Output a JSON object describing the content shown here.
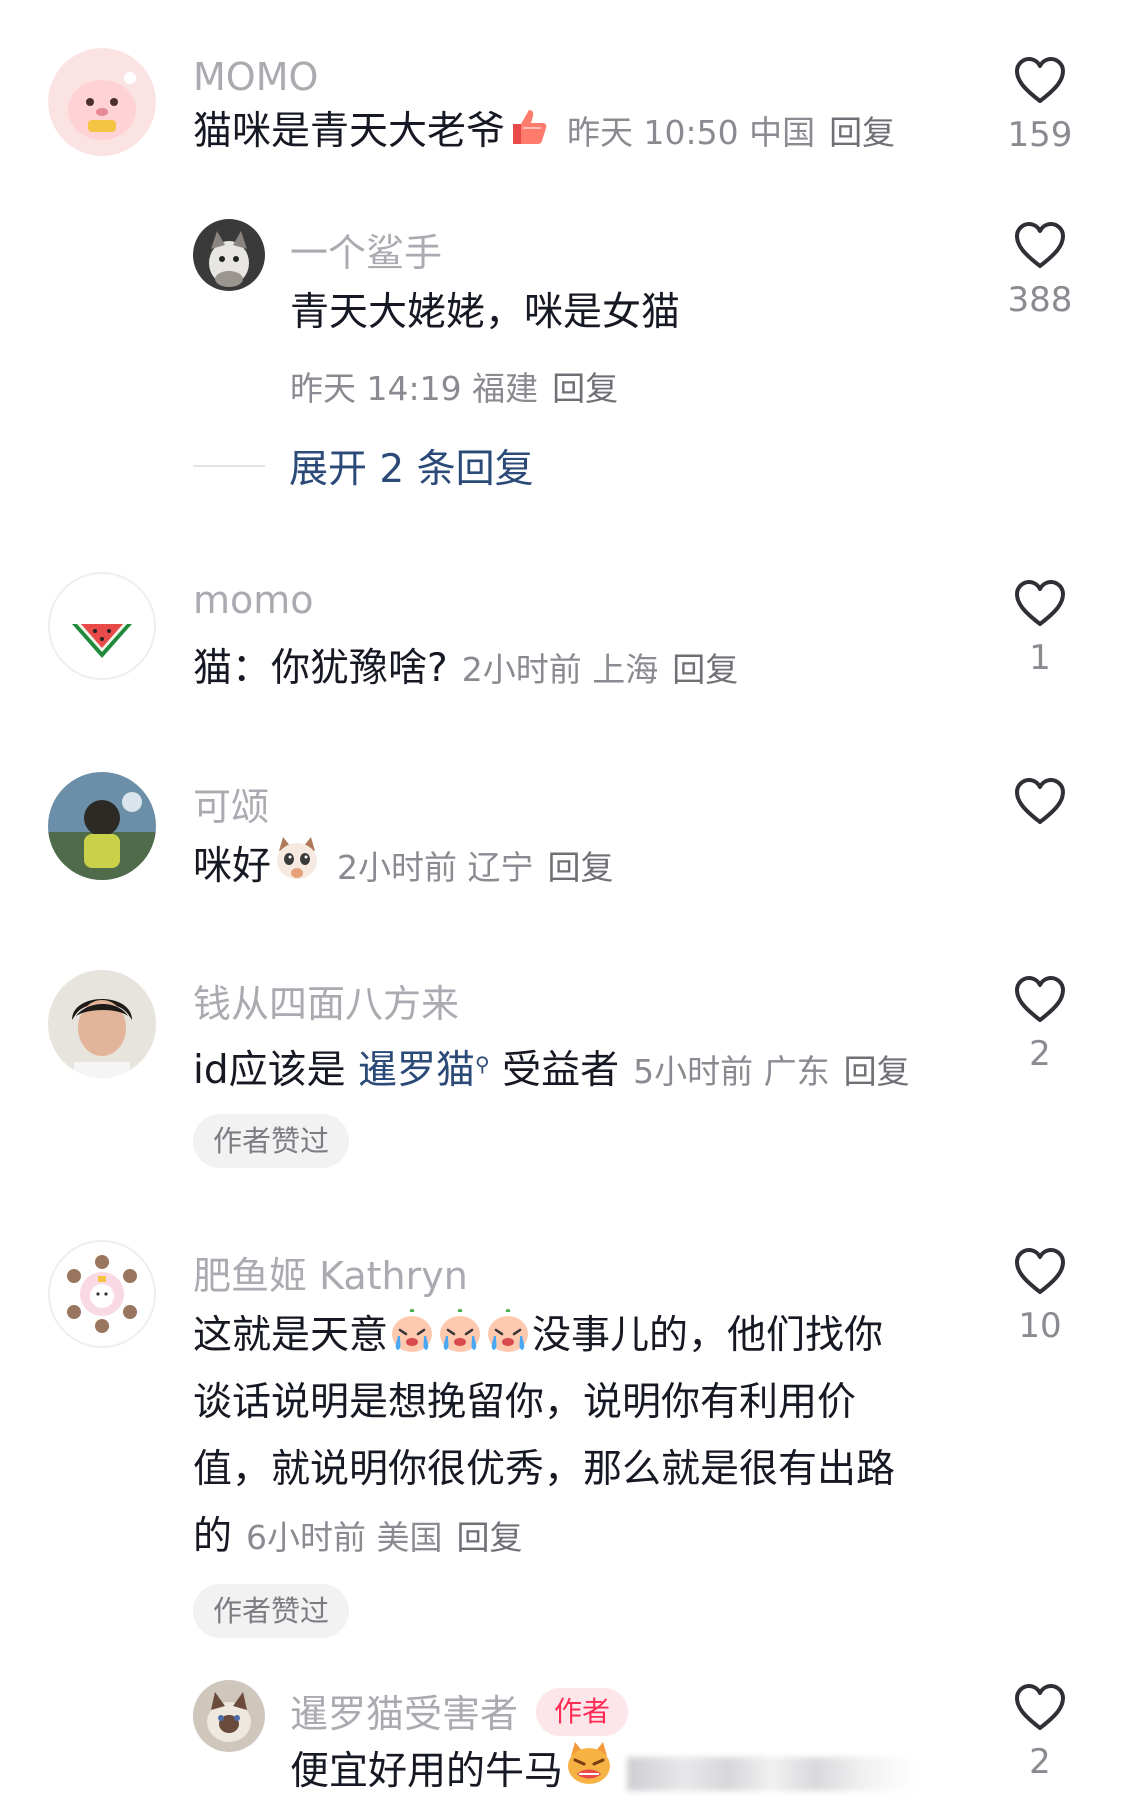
{
  "comments": [
    {
      "username": "MOMO",
      "text": "猫咪是青天大老爷",
      "time": "昨天 10:50",
      "location": "中国",
      "reply_label": "回复",
      "likes": "159",
      "emoji": "thumbs-up-emoji",
      "replies": [
        {
          "username": "一个鲨手",
          "text": "青天大姥姥，咪是女猫",
          "time": "昨天 14:19",
          "location": "福建",
          "reply_label": "回复",
          "likes": "388"
        }
      ],
      "expand_label": "展开 2 条回复"
    },
    {
      "username": "momo",
      "text": "猫：你犹豫啥?",
      "time": "2小时前",
      "location": "上海",
      "reply_label": "回复",
      "likes": "1"
    },
    {
      "username": "可颂",
      "text": "咪好",
      "time": "2小时前",
      "location": "辽宁",
      "reply_label": "回复",
      "likes": "",
      "emoji": "cat-thinking-emoji"
    },
    {
      "username": "钱从四面八方来",
      "text_before": "id应该是 ",
      "mention": "暹罗猫",
      "text_after": " 受益者",
      "time": "5小时前",
      "location": "广东",
      "reply_label": "回复",
      "likes": "2",
      "author_liked": "作者赞过"
    },
    {
      "username": "肥鱼姬 Kathryn",
      "lines": [
        "这就是天意",
        "没事儿的，他们找你",
        "谈话说明是想挽留你，说明你有利用价",
        "值，就说明你很优秀，那么就是很有出路",
        "的"
      ],
      "time": "6小时前",
      "location": "美国",
      "reply_label": "回复",
      "likes": "10",
      "emoji": "crying-peach-emoji",
      "author_liked": "作者赞过",
      "replies": [
        {
          "username": "暹罗猫受害者",
          "author_tag": "作者",
          "text": "便宜好用的牛马",
          "likes": "2",
          "emoji": "angry-cat-emoji"
        }
      ]
    }
  ],
  "icons": {
    "like": "heart-outline-icon"
  },
  "colors": {
    "link": "#2b4a78",
    "author_tag": "#fe2c55",
    "muted": "#a9abb0"
  }
}
